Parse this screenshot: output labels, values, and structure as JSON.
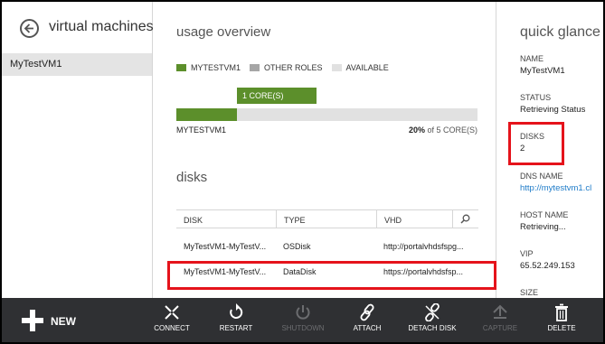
{
  "left_panel": {
    "title": "virtual machines",
    "items": [
      {
        "label": "MyTestVM1"
      }
    ]
  },
  "usage": {
    "title": "usage overview",
    "legend": [
      {
        "label": "MYTESTVM1",
        "color": "#5c8f2b"
      },
      {
        "label": "OTHER ROLES",
        "color": "#a6a6a6"
      },
      {
        "label": "AVAILABLE",
        "color": "#e1e1e1"
      }
    ],
    "core_tag": "1 CORE(S)",
    "bar_fraction": 0.2,
    "bar_label": "MYTESTVM1",
    "bar_pct": "20%",
    "bar_pct_rest": " of 5 CORE(S)"
  },
  "disks": {
    "title": "disks",
    "columns": [
      "DISK",
      "TYPE",
      "VHD"
    ],
    "rows": [
      {
        "disk": "MyTestVM1-MyTestV...",
        "type": "OSDisk",
        "vhd": "http://portalvhdsfspg..."
      },
      {
        "disk": "MyTestVM1-MyTestV...",
        "type": "DataDisk",
        "vhd": "https://portalvhdsfsp..."
      }
    ]
  },
  "quick_glance": {
    "title": "quick glance",
    "fields": [
      {
        "label": "NAME",
        "value": "MyTestVM1"
      },
      {
        "label": "STATUS",
        "value": "Retrieving Status"
      },
      {
        "label": "DISKS",
        "value": "2"
      },
      {
        "label": "DNS NAME",
        "value": "http://mytestvm1.cl"
      },
      {
        "label": "HOST NAME",
        "value": "Retrieving..."
      },
      {
        "label": "VIP",
        "value": "65.52.249.153"
      },
      {
        "label": "SIZE",
        "value": ""
      }
    ]
  },
  "command_bar": {
    "new_label": "NEW",
    "commands": [
      {
        "label": "CONNECT",
        "icon": "connect-icon",
        "enabled": true
      },
      {
        "label": "RESTART",
        "icon": "restart-icon",
        "enabled": true
      },
      {
        "label": "SHUTDOWN",
        "icon": "power-icon",
        "enabled": false
      },
      {
        "label": "ATTACH",
        "icon": "attach-icon",
        "enabled": true
      },
      {
        "label": "DETACH DISK",
        "icon": "detach-icon",
        "enabled": true
      },
      {
        "label": "CAPTURE",
        "icon": "capture-icon",
        "enabled": false
      },
      {
        "label": "DELETE",
        "icon": "trash-icon",
        "enabled": true
      }
    ]
  },
  "colors": {
    "accent_green": "#5c8f2b",
    "highlight_red": "#e5131b",
    "command_bar_bg": "#2f3033",
    "link_blue": "#1e7bc8"
  }
}
